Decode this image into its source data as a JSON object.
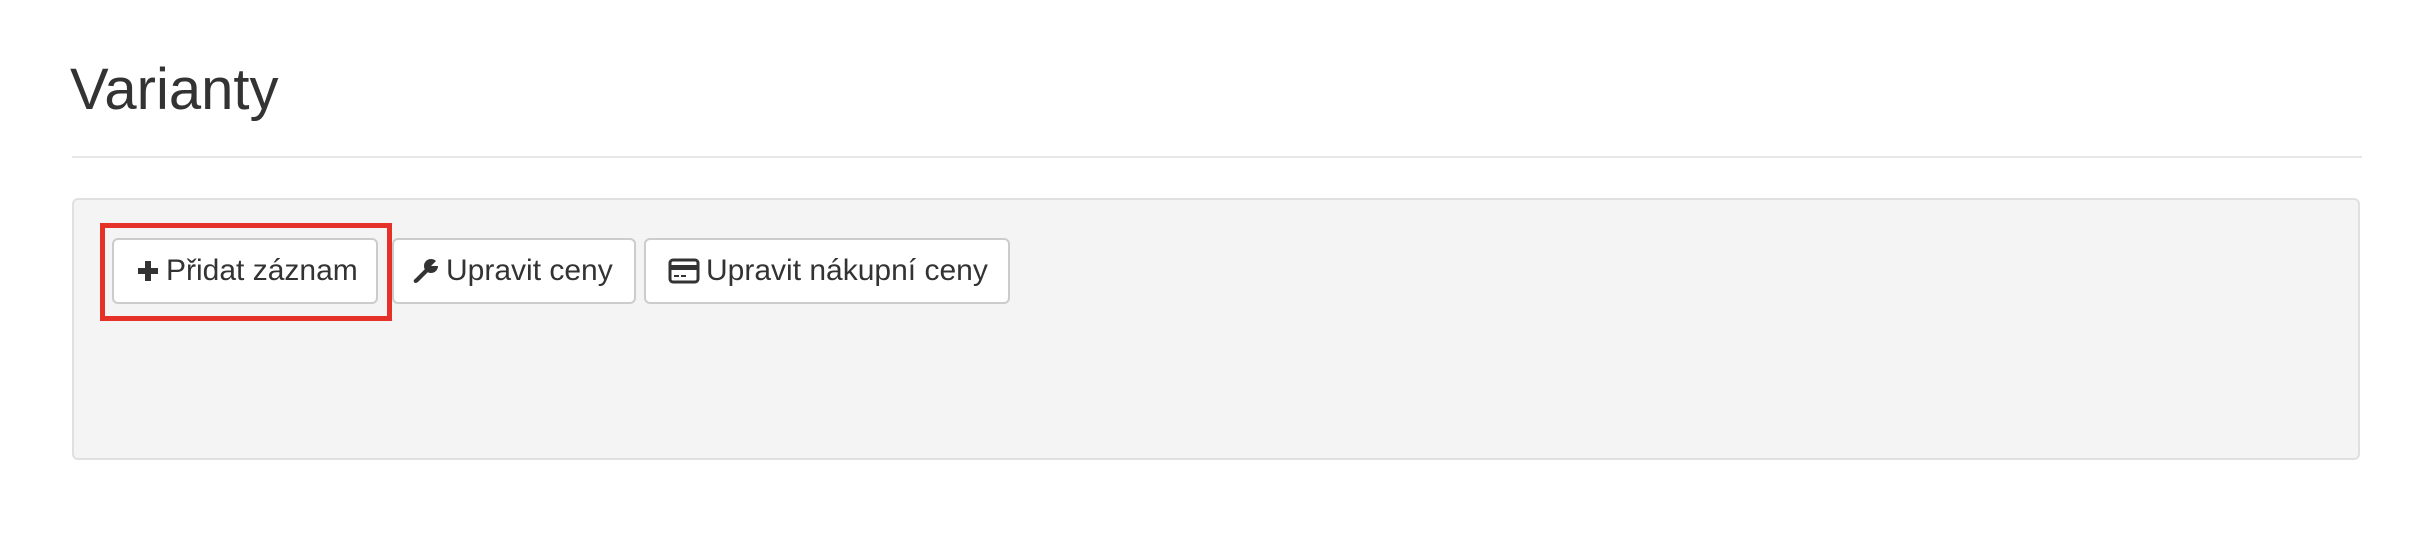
{
  "page": {
    "title": "Varianty"
  },
  "toolbar": {
    "buttons": [
      {
        "label": "Přidat záznam",
        "icon": "plus-icon"
      },
      {
        "label": "Upravit ceny",
        "icon": "wrench-icon"
      },
      {
        "label": "Upravit nákupní ceny",
        "icon": "credit-card-icon"
      }
    ]
  },
  "colors": {
    "highlight": "#e53127",
    "panel_background": "#f4f4f4",
    "text": "#333333"
  }
}
